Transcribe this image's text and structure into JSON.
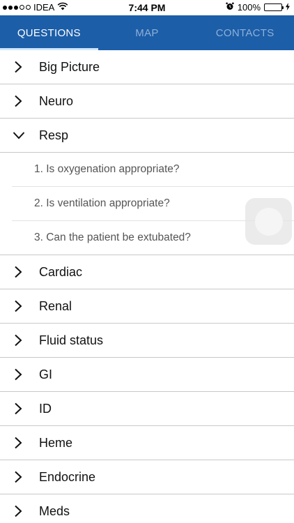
{
  "status_bar": {
    "carrier": "IDEA",
    "time": "7:44 PM",
    "battery": "100%",
    "battery_level": 1.0,
    "icons": [
      "signal-dots-icon",
      "wifi-icon",
      "alarm-icon",
      "battery-icon",
      "charging-bolt-icon"
    ]
  },
  "tabs": [
    {
      "label": "QUESTIONS",
      "active": true
    },
    {
      "label": "MAP",
      "active": false
    },
    {
      "label": "CONTACTS",
      "active": false
    }
  ],
  "colors": {
    "header_bg": "#1c5ea8",
    "tab_active": "#ffffff",
    "tab_inactive": "#8fb0d8",
    "tab_indicator": "#cfe6ff",
    "battery_fill": "#2ac940"
  },
  "sections": [
    {
      "label": "Big Picture",
      "expanded": false
    },
    {
      "label": "Neuro",
      "expanded": false
    },
    {
      "label": "Resp",
      "expanded": true,
      "items": [
        "1. Is oxygenation appropriate?",
        "2. Is ventilation appropriate?",
        "3. Can the patient be extubated?"
      ]
    },
    {
      "label": "Cardiac",
      "expanded": false
    },
    {
      "label": "Renal",
      "expanded": false
    },
    {
      "label": "Fluid status",
      "expanded": false
    },
    {
      "label": "GI",
      "expanded": false
    },
    {
      "label": "ID",
      "expanded": false
    },
    {
      "label": "Heme",
      "expanded": false
    },
    {
      "label": "Endocrine",
      "expanded": false
    },
    {
      "label": "Meds",
      "expanded": false
    }
  ]
}
